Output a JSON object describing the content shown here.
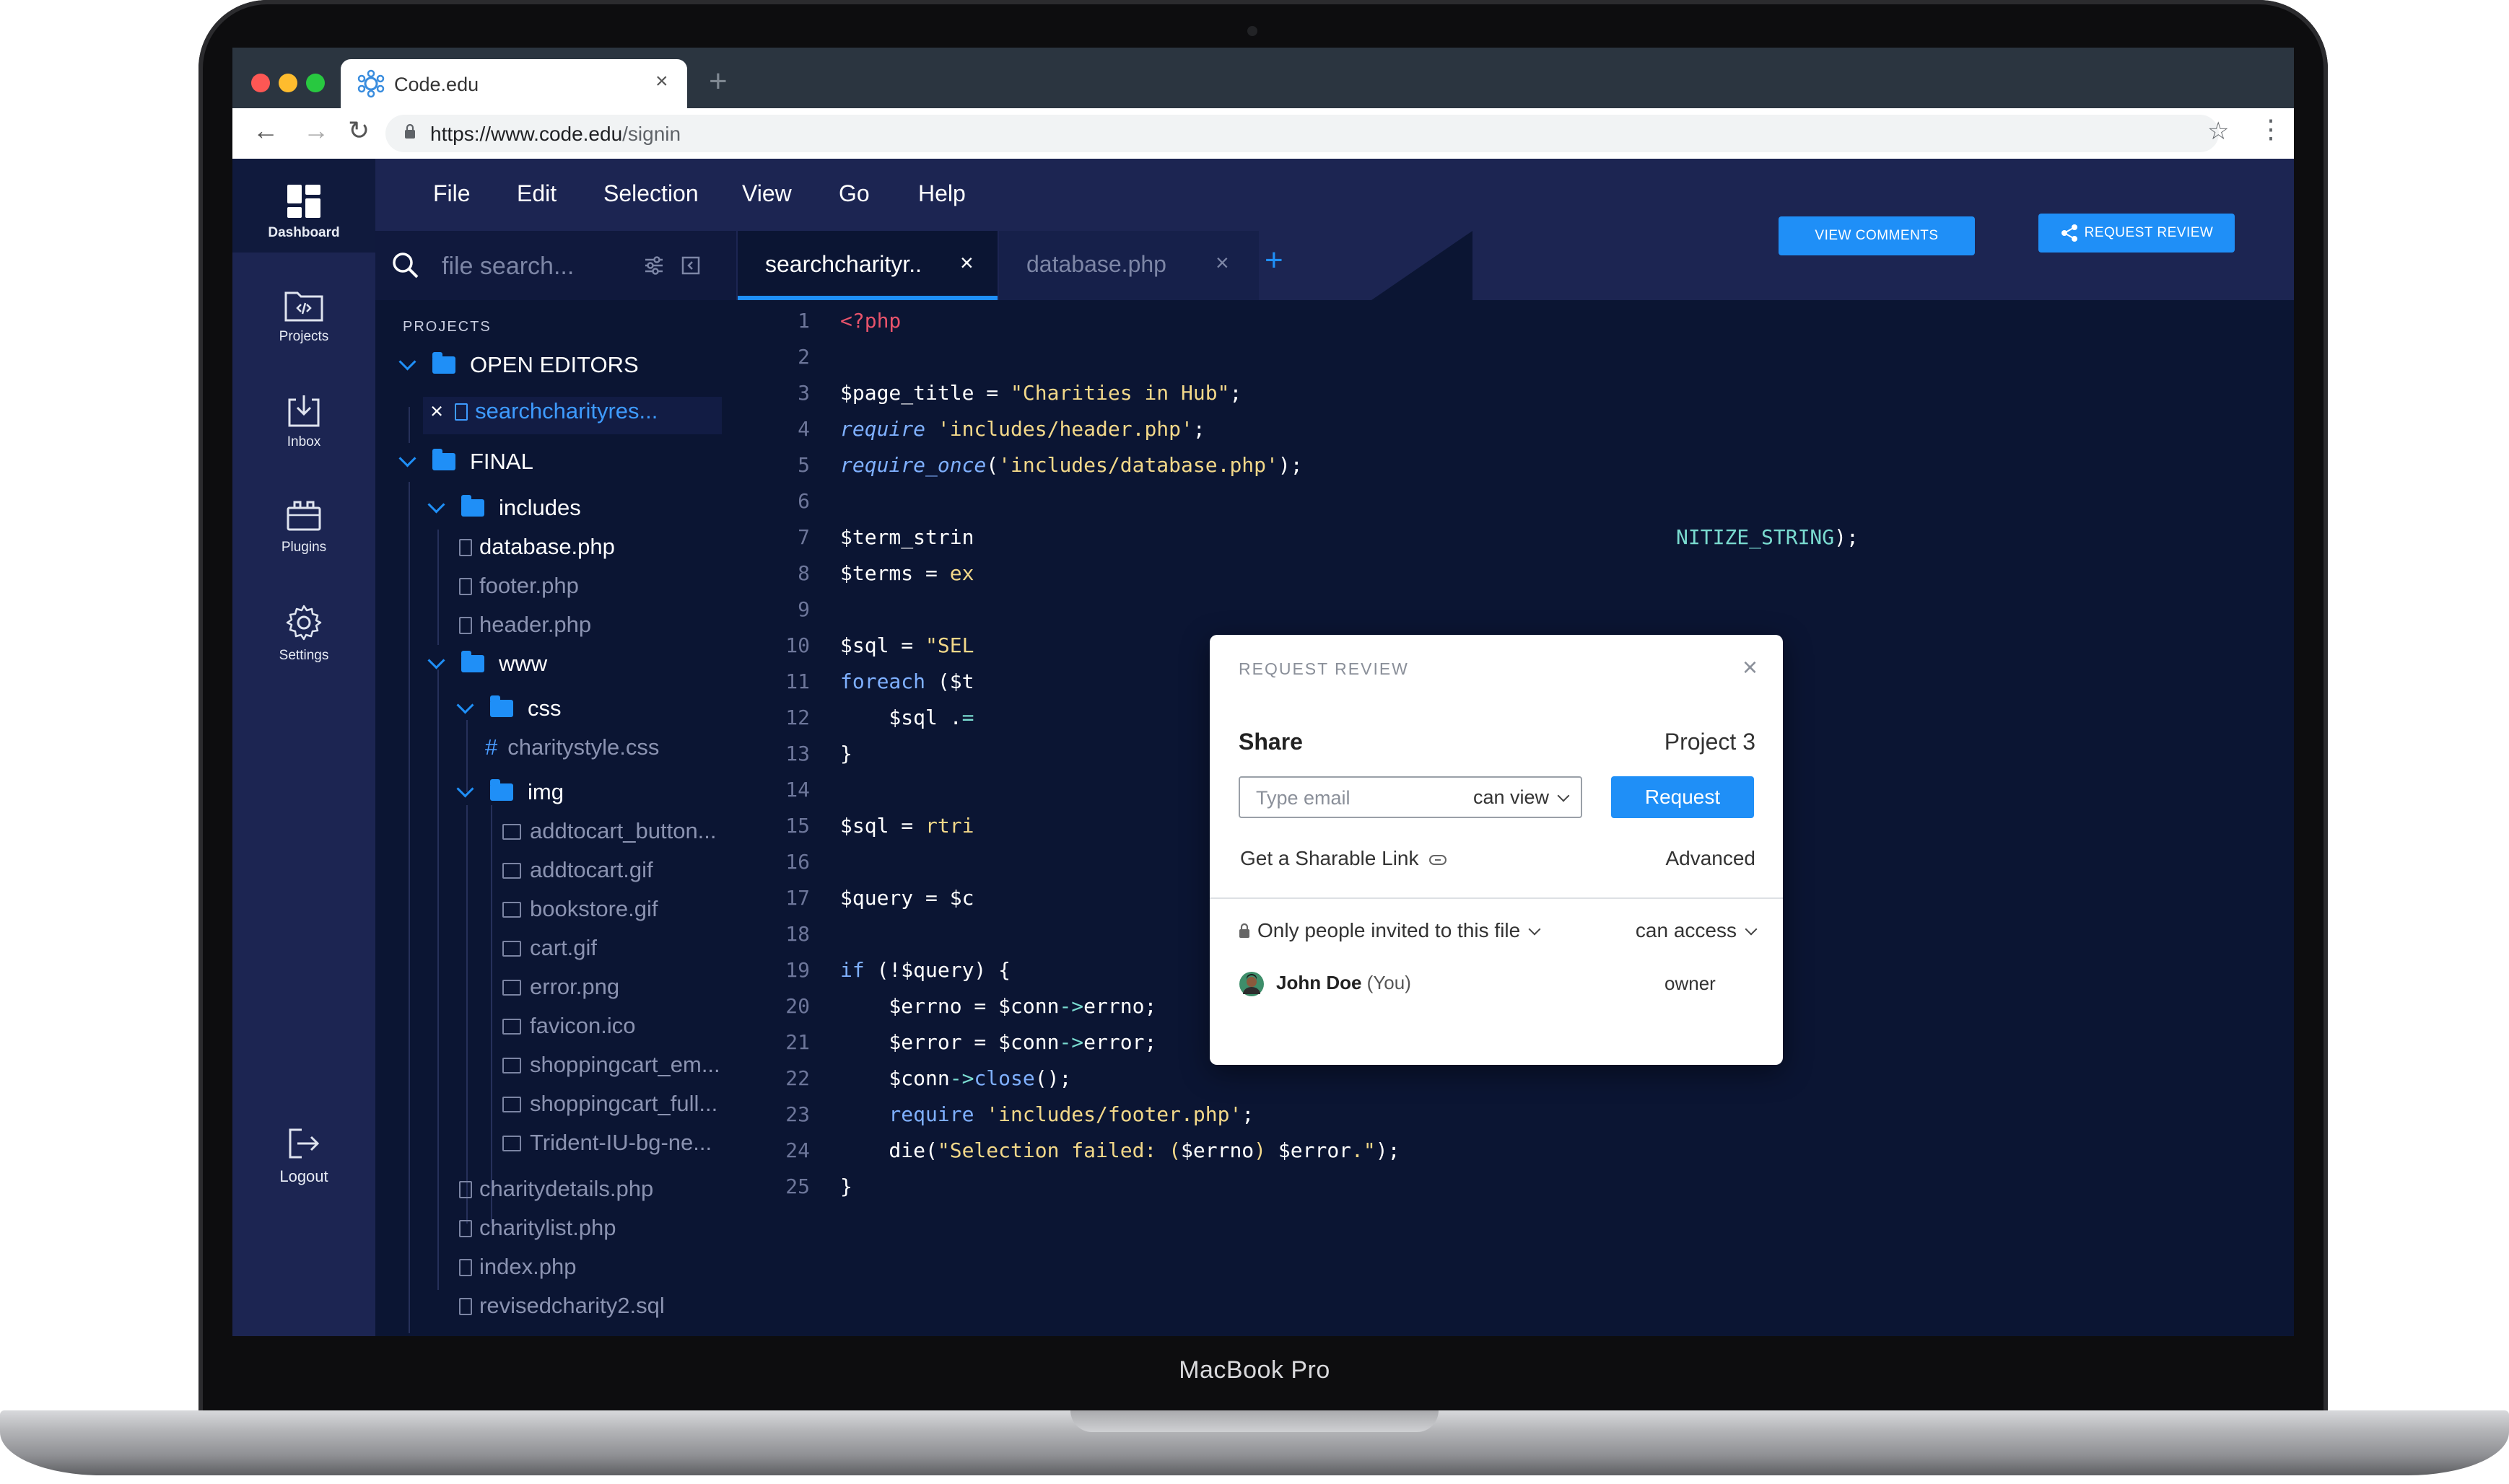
{
  "device": {
    "label": "MacBook Pro"
  },
  "browser": {
    "tab_title": "Code.edu",
    "new_tab": "+",
    "url_host": "https://www.code.edu",
    "url_path": "/signin"
  },
  "sidebar": {
    "items": [
      {
        "label": "Dashboard",
        "icon": "dashboard-icon"
      },
      {
        "label": "Projects",
        "icon": "projects-icon"
      },
      {
        "label": "Inbox",
        "icon": "inbox-icon"
      },
      {
        "label": "Plugins",
        "icon": "plugins-icon"
      },
      {
        "label": "Settings",
        "icon": "gear-icon"
      }
    ],
    "logout": "Logout"
  },
  "menu": {
    "items": [
      "File",
      "Edit",
      "Selection",
      "View",
      "Go",
      "Help"
    ]
  },
  "actions": {
    "view_comments": "VIEW COMMENTS",
    "request_review": "REQUEST REVIEW"
  },
  "search": {
    "placeholder": "file search..."
  },
  "editor_tabs": [
    {
      "title": "searchcharityr..",
      "close": "×"
    },
    {
      "title": "database.php",
      "close": "×"
    }
  ],
  "add_tab": "+",
  "explorer": {
    "heading": "PROJECTS",
    "open_editors": "OPEN EDITORS",
    "open_file_close": "×",
    "open_file": "searchcharityres...",
    "final": "FINAL",
    "includes": "includes",
    "includes_files": [
      "database.php",
      "footer.php",
      "header.php"
    ],
    "www": "www",
    "css": "css",
    "css_files": [
      "charitystyle.css"
    ],
    "css_hash": "#",
    "img": "img",
    "img_files": [
      "addtocart_button...",
      "addtocart.gif",
      "bookstore.gif",
      "cart.gif",
      "error.png",
      "favicon.ico",
      "shoppingcart_em...",
      "shoppingcart_full...",
      "Trident-IU-bg-ne..."
    ],
    "root_files": [
      "charitydetails.php",
      "charitylist.php",
      "index.php",
      "revisedcharity2.sql"
    ]
  },
  "code": {
    "line_numbers": [
      "1",
      "2",
      "3",
      "4",
      "5",
      "6",
      "7",
      "8",
      "9",
      "10",
      "11",
      "12",
      "13",
      "14",
      "15",
      "16",
      "17",
      "18",
      "19",
      "20",
      "21",
      "22",
      "23",
      "24",
      "25"
    ],
    "l1": "<?php",
    "l3a": "$page_title = ",
    "l3b": "\"Charities in Hub\"",
    "l3c": ";",
    "l4a": "require",
    "l4b": " 'includes/header.php'",
    "l4c": ";",
    "l5a": "require_once",
    "l5b": "(",
    "l5c": "'includes/database.php'",
    "l5d": ");",
    "l7a": "$term_strin",
    "l7b": "NITIZE_STRING",
    "l7c": ");",
    "l8a": "$terms = ",
    "l8b": "ex",
    "l10a": "$sql = ",
    "l10b": "\"SEL",
    "l11a": "foreach",
    "l11b": " ($t",
    "l12a": "    $sql .",
    "l12b": "=",
    "l13": "}",
    "l15a": "$sql = ",
    "l15b": "rtri",
    "l17a": "$query = ",
    "l17b": "$c",
    "l19a": "if",
    "l19b": " (!$query) {",
    "l20a": "    $errno = $conn",
    "l20b": "->",
    "l20c": "errno;",
    "l21a": "    $error = $conn",
    "l21b": "->",
    "l21c": "error;",
    "l22a": "    $conn",
    "l22b": "->",
    "l22c": "close",
    "l22d": "();",
    "l23a": "    require",
    "l23b": " 'includes/footer.php'",
    "l23c": ";",
    "l24a": "    die(",
    "l24b": "\"Selection failed: (",
    "l24c": "$errno",
    "l24d": ") ",
    "l24e": "$error",
    "l24f": ".\"",
    "l24g": ");",
    "l25": "}"
  },
  "popup": {
    "heading": "REQUEST REVIEW",
    "close": "×",
    "share": "Share",
    "project": "Project 3",
    "email_placeholder": "Type email",
    "permission": "can view",
    "request_button": "Request",
    "share_link": "Get a Sharable Link",
    "advanced": "Advanced",
    "only_invited": "Only people invited to this file",
    "access": "can access",
    "user_name": "John Doe",
    "user_suffix": " (You)",
    "user_role": "owner"
  }
}
